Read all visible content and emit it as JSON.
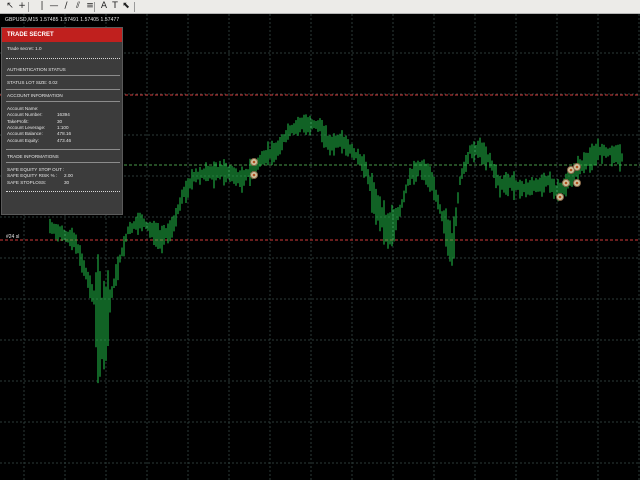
{
  "toolbar": {
    "tools": [
      {
        "name": "cursor-icon",
        "glyph": "↖"
      },
      {
        "name": "crosshair-icon",
        "glyph": "+"
      },
      {
        "name": "vertical-line-icon",
        "glyph": "|"
      },
      {
        "name": "horizontal-line-icon",
        "glyph": "—"
      },
      {
        "name": "trendline-icon",
        "glyph": "/"
      },
      {
        "name": "equidistant-channel-icon",
        "glyph": "⫽"
      },
      {
        "name": "fibonacci-icon",
        "glyph": "≡"
      },
      {
        "name": "text-icon",
        "glyph": "A"
      },
      {
        "name": "text-label-icon",
        "glyph": "T"
      },
      {
        "name": "arrows-icon",
        "glyph": "⬉"
      }
    ]
  },
  "chart": {
    "symbol_info": "GBPUSD,M15  1.57485 1.57491 1.57405 1.57477",
    "price_label": "#24 sl",
    "colors": {
      "background": "#000000",
      "grid": "#2b3a38",
      "candle": "#22c44a",
      "red_level": "#d23a3a",
      "green_level": "#4a9a4a"
    }
  },
  "panel": {
    "title": "TRADE SECRET",
    "version": "Trade secret: 1.0",
    "authentication_status": "AUTHENTICATION STATUS",
    "status_lot_size": "STATUS LOT SIZE:  0.02",
    "account_information": "ACCOUNT INFORMATION",
    "account_rows": [
      {
        "label": "Account Name:",
        "value": ""
      },
      {
        "label": "Account Number:",
        "value": "16394"
      },
      {
        "label": "TakeProfit:",
        "value": "30"
      },
      {
        "label": "Account Leverage:",
        "value": "1:100"
      },
      {
        "label": "Account Balance:",
        "value": "478.16"
      },
      {
        "label": "Account Equity:",
        "value": "473.46"
      }
    ],
    "trade_informations": "TRADE INFORMATIONS",
    "safe_rows": [
      {
        "label": "SAFE EQUITY STOP OUT :",
        "value": ""
      },
      {
        "label": "SAFE EQUITY RISK % :",
        "value": "2.00"
      },
      {
        "label": "SAFE STOPLOSS:",
        "value": "30"
      }
    ]
  }
}
